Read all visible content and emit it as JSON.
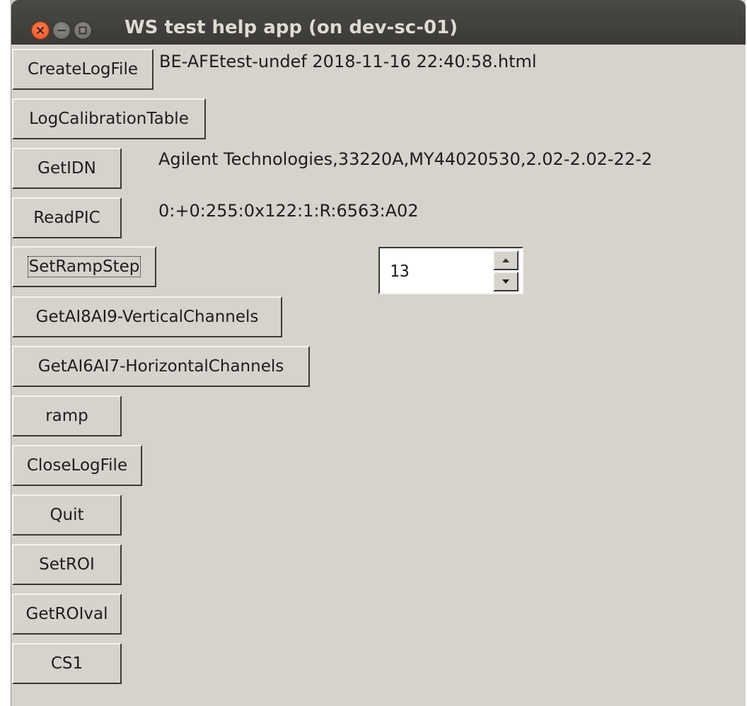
{
  "window": {
    "title": "WS test help app (on dev-sc-01)",
    "background": "#d6d2cc",
    "titlebar_color": "#3d3c39",
    "close_color": "#e2511c"
  },
  "buttons": {
    "create_log_file": "CreateLogFile",
    "log_calibration_table": "LogCalibrationTable",
    "get_idn": "GetIDN",
    "read_pic": "ReadPIC",
    "set_ramp_step": "SetRampStep",
    "get_ai8ai9": "GetAI8AI9-VerticalChannels",
    "get_ai6ai7": "GetAI6AI7-HorizontalChannels",
    "ramp": "ramp",
    "close_log_file": "CloseLogFile",
    "quit": "Quit",
    "set_roi": "SetROI",
    "get_roi_val": "GetROIval",
    "cs1": "CS1"
  },
  "outputs": {
    "log_file_name": "BE-AFEtest-undef 2018-11-16 22:40:58.html",
    "idn": "Agilent Technologies,33220A,MY44020530,2.02-2.02-22-2",
    "pic": "0:+0:255:0x122:1:R:6563:A02"
  },
  "ramp_step": {
    "value": "13"
  },
  "icons": {
    "close": "close-icon",
    "minimize": "minimize-icon",
    "maximize": "maximize-icon",
    "spin_up": "arrow-up-icon",
    "spin_down": "arrow-down-icon"
  }
}
